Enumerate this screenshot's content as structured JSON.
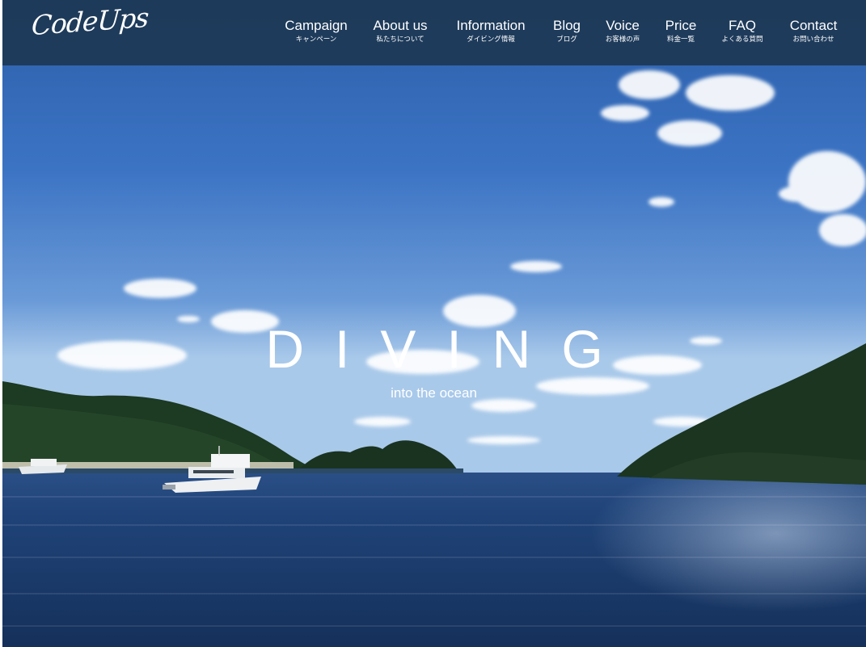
{
  "header": {
    "logo": "CodeUps",
    "nav": [
      {
        "label": "Campaign",
        "sub": "キャンペーン",
        "id": "campaign"
      },
      {
        "label": "About us",
        "sub": "私たちについて",
        "id": "about"
      },
      {
        "label": "Information",
        "sub": "ダイビング情報",
        "id": "information"
      },
      {
        "label": "Blog",
        "sub": "ブログ",
        "id": "blog"
      },
      {
        "label": "Voice",
        "sub": "お客様の声",
        "id": "voice"
      },
      {
        "label": "Price",
        "sub": "料金一覧",
        "id": "price"
      },
      {
        "label": "FAQ",
        "sub": "よくある質問",
        "id": "faq"
      },
      {
        "label": "Contact",
        "sub": "お問い合わせ",
        "id": "contact"
      }
    ]
  },
  "hero": {
    "title": "DIVING",
    "subtitle": "into the ocean"
  },
  "colors": {
    "header_bg": "#1c344d",
    "sky_top": "#2f63b5",
    "sky_horizon": "#9cc3e8",
    "sea": "#1d3f72",
    "text": "#ffffff"
  }
}
